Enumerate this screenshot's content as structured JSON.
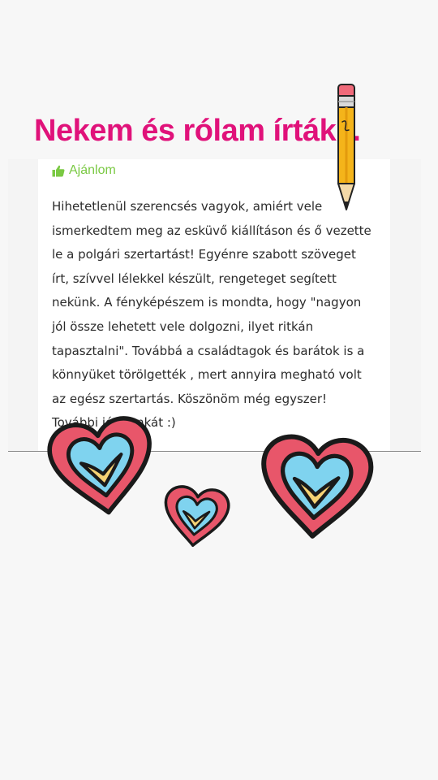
{
  "title": "Nekem és rólam írták...",
  "recommend": {
    "label": "Ajánlom",
    "icon": "thumbs-up-icon",
    "color": "#7ac943"
  },
  "review": {
    "text": "Hihetetlenül szerencsés vagyok, amiért vele ismerkedtem meg az esküvő kiállításon és ő vezette le a polgári szertartást! Egyénre szabott szöveget írt, szívvel lélekkel készült, rengeteget segített nekünk. A fényképészem is mondta, hogy \"nagyon jól össze lehetett vele dolgozni, ilyet ritkán tapasztalni\". Továbbá a családtagok és barátok is a könnyüket törölgették , mert annyira megható volt az egész szertartás. Köszönöm még egyszer! További jó munkát :)"
  },
  "colors": {
    "title": "#e0127a",
    "heart_outer": "#e8566a",
    "heart_middle": "#7fd3ef",
    "heart_inner": "#f5d274"
  },
  "decorations": [
    "pencil-icon",
    "heart-icon",
    "heart-icon",
    "heart-icon"
  ]
}
